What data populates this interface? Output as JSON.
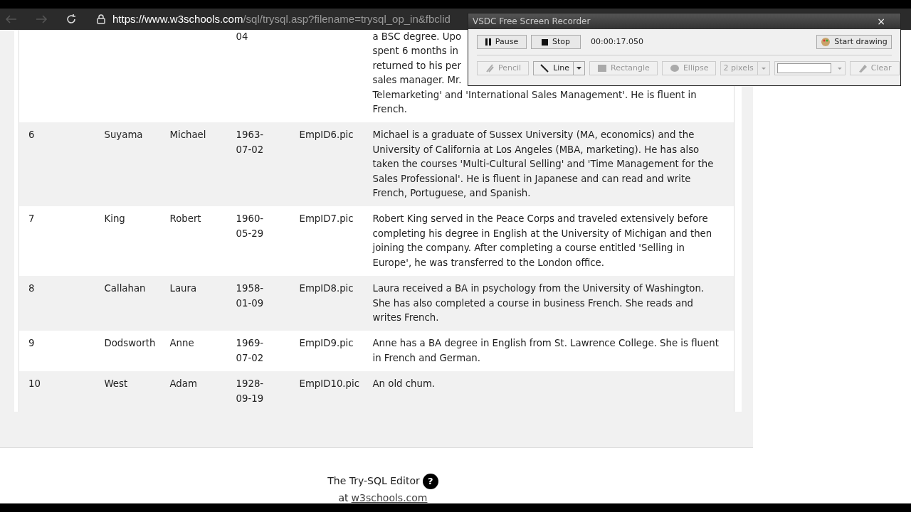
{
  "browser": {
    "url_host": "https://www.w3schools.com",
    "url_path": "/sql/trysql.asp?filename=trysql_op_in&fbclid"
  },
  "table": {
    "partial_row": {
      "birth_date": "04",
      "notes_lines": [
        "a BSC degree. Upo",
        "spent 6 months in",
        "returned to his per",
        "sales manager. Mr.",
        "Telemarketing' and 'International Sales Management'. He is fluent in",
        "French."
      ]
    },
    "rows": [
      {
        "id": "6",
        "last_name": "Suyama",
        "first_name": "Michael",
        "birth_date": "1963-07-02",
        "photo": "EmpID6.pic",
        "notes": "Michael is a graduate of Sussex University (MA, economics) and the University of California at Los Angeles (MBA, marketing). He has also taken the courses 'Multi-Cultural Selling' and 'Time Management for the Sales Professional'. He is fluent in Japanese and can read and write French, Portuguese, and Spanish."
      },
      {
        "id": "7",
        "last_name": "King",
        "first_name": "Robert",
        "birth_date": "1960-05-29",
        "photo": "EmpID7.pic",
        "notes": "Robert King served in the Peace Corps and traveled extensively before completing his degree in English at the University of Michigan and then joining the company. After completing a course entitled 'Selling in Europe', he was transferred to the London office."
      },
      {
        "id": "8",
        "last_name": "Callahan",
        "first_name": "Laura",
        "birth_date": "1958-01-09",
        "photo": "EmpID8.pic",
        "notes": "Laura received a BA in psychology from the University of Washington. She has also completed a course in business French. She reads and writes French."
      },
      {
        "id": "9",
        "last_name": "Dodsworth",
        "first_name": "Anne",
        "birth_date": "1969-07-02",
        "photo": "EmpID9.pic",
        "notes": "Anne has a BA degree in English from St. Lawrence College. She is fluent in French and German."
      },
      {
        "id": "10",
        "last_name": "West",
        "first_name": "Adam",
        "birth_date": "1928-09-19",
        "photo": "EmpID10.pic",
        "notes": "An old chum."
      }
    ]
  },
  "footer": {
    "title": "The Try-SQL Editor",
    "help": "?",
    "prefix": "at",
    "link": "w3schools.com"
  },
  "recorder": {
    "title": "VSDC Free Screen Recorder",
    "close": "×",
    "pause": "Pause",
    "stop": "Stop",
    "time": "00:00:17.050",
    "start_drawing": "Start drawing",
    "tools": [
      {
        "kind": "button",
        "label": "Pencil",
        "disabled": true
      },
      {
        "kind": "split",
        "label": "Line",
        "disabled": false
      },
      {
        "kind": "button",
        "label": "Rectangle",
        "disabled": true
      },
      {
        "kind": "button",
        "label": "Ellipse",
        "disabled": true
      },
      {
        "kind": "select",
        "label": "2 pixels",
        "disabled": true
      },
      {
        "kind": "color",
        "disabled": true
      },
      {
        "kind": "button",
        "label": "Clear",
        "disabled": true
      }
    ]
  }
}
